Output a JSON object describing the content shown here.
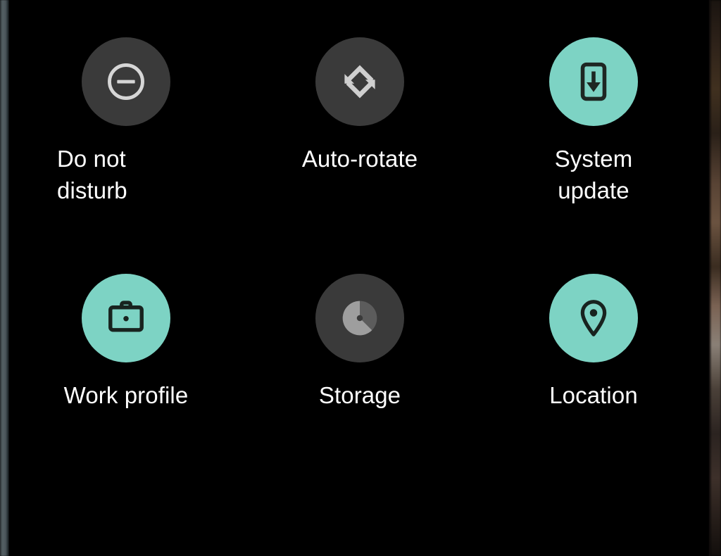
{
  "screen": {
    "title": "Android Quick Settings tiles",
    "background_color": "#000000",
    "accent_color": "#7dd3c4",
    "inactive_color": "#3a3a3a",
    "label_color": "#ffffff"
  },
  "tiles": [
    {
      "id": "do-not-disturb",
      "label": "Do not disturb",
      "icon": "do-not-disturb-icon",
      "state": "off",
      "background": "#3a3a3a",
      "icon_color": "#d6d6d6"
    },
    {
      "id": "auto-rotate",
      "label": "Auto-rotate",
      "icon": "screen-rotation-icon",
      "state": "off",
      "background": "#3a3a3a",
      "icon_color": "#cfcfcf"
    },
    {
      "id": "system-update",
      "label": "System update",
      "icon": "system-update-icon",
      "state": "on",
      "background": "#7dd3c4",
      "icon_color": "#1e2723"
    },
    {
      "id": "work-profile",
      "label": "Work profile",
      "icon": "briefcase-icon",
      "state": "on",
      "background": "#7dd3c4",
      "icon_color": "#18231f"
    },
    {
      "id": "storage",
      "label": "Storage",
      "icon": "storage-pie-icon",
      "state": "off",
      "background": "#3a3a3a",
      "icon_color": "#9e9e9e"
    },
    {
      "id": "location",
      "label": "Location",
      "icon": "location-pin-icon",
      "state": "on",
      "background": "#7dd3c4",
      "icon_color": "#18231f"
    }
  ]
}
